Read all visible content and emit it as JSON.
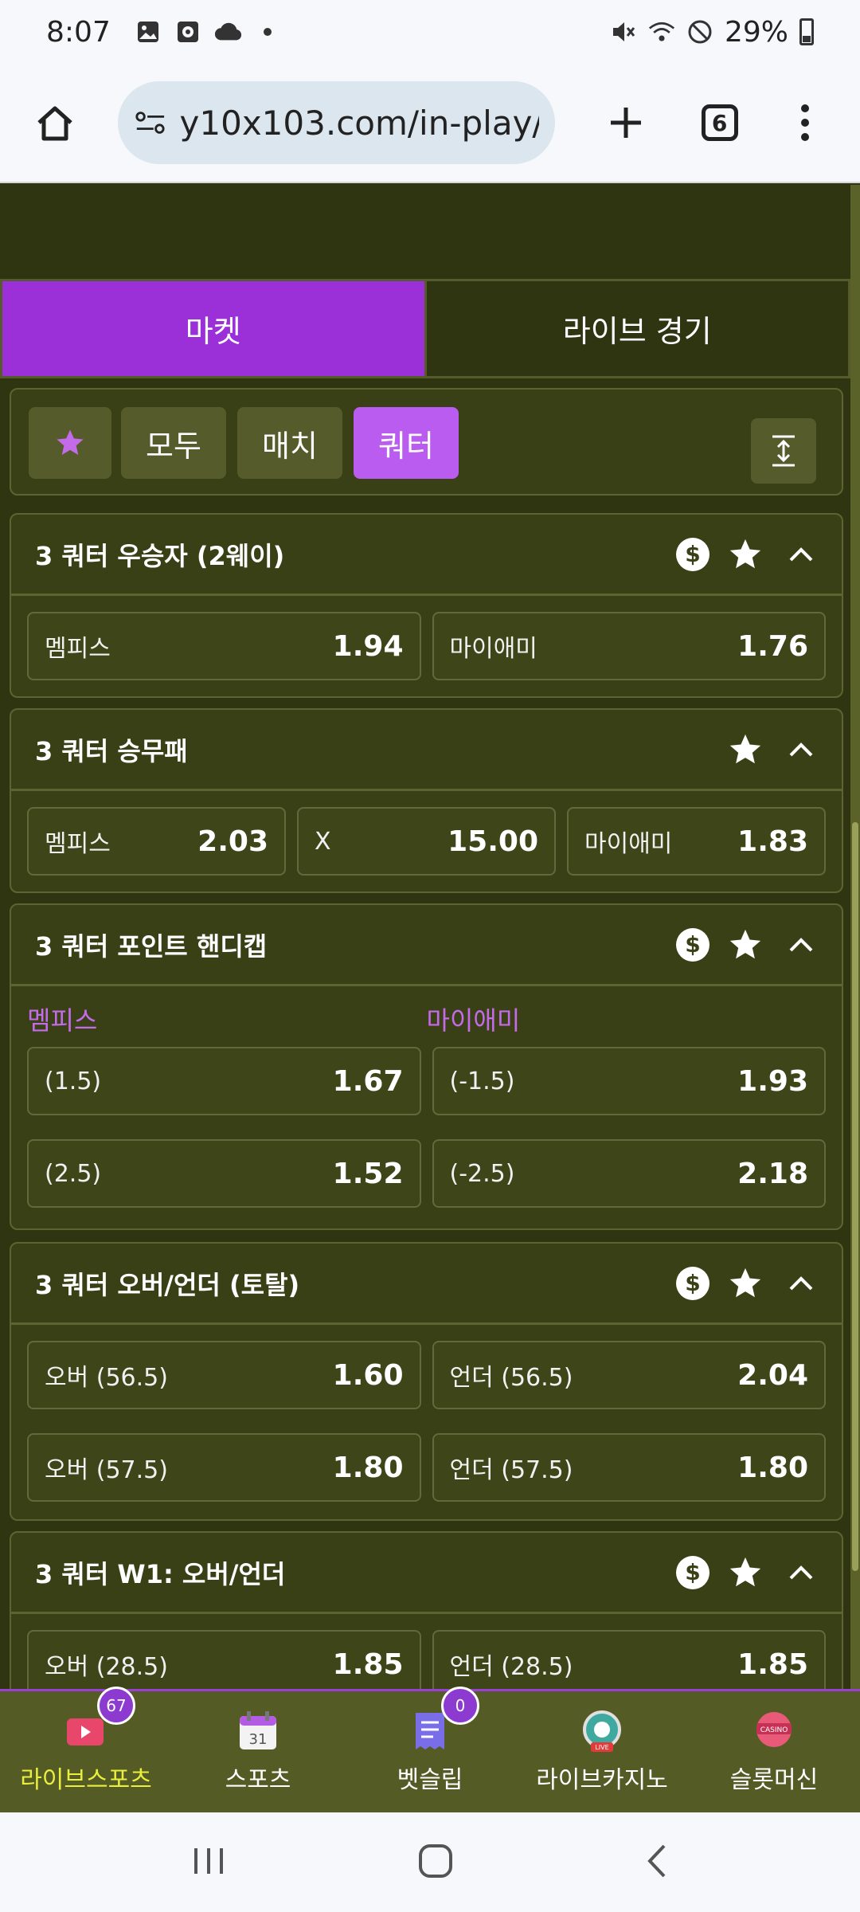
{
  "status_bar": {
    "time": "8:07",
    "battery": "29%"
  },
  "browser": {
    "url": "y10x103.com/in-play/r",
    "tab_count": "6"
  },
  "main_tabs": {
    "markets": "마켓",
    "live": "라이브 경기"
  },
  "filters": {
    "all": "모두",
    "match": "매치",
    "quarter": "쿼터"
  },
  "markets": [
    {
      "title": "3 쿼터 우승자 (2웨이)",
      "odds": [
        {
          "label": "멤피스",
          "value": "1.94"
        },
        {
          "label": "마이애미",
          "value": "1.76"
        }
      ]
    },
    {
      "title": "3 쿼터 승무패",
      "odds": [
        {
          "label": "멤피스",
          "value": "2.03"
        },
        {
          "label": "X",
          "value": "15.00"
        },
        {
          "label": "마이애미",
          "value": "1.83"
        }
      ]
    },
    {
      "title": "3 쿼터 포인트 핸디캡",
      "team_home": "멤피스",
      "team_away": "마이애미",
      "rows": [
        [
          {
            "label": "(1.5)",
            "value": "1.67"
          },
          {
            "label": "(-1.5)",
            "value": "1.93"
          }
        ],
        [
          {
            "label": "(2.5)",
            "value": "1.52"
          },
          {
            "label": "(-2.5)",
            "value": "2.18"
          }
        ]
      ]
    },
    {
      "title": "3 쿼터 오버/언더 (토탈)",
      "rows": [
        [
          {
            "label": "오버 (56.5)",
            "value": "1.60"
          },
          {
            "label": "언더 (56.5)",
            "value": "2.04"
          }
        ],
        [
          {
            "label": "오버 (57.5)",
            "value": "1.80"
          },
          {
            "label": "언더 (57.5)",
            "value": "1.80"
          }
        ]
      ]
    },
    {
      "title": "3 쿼터 W1: 오버/언더",
      "rows": [
        [
          {
            "label": "오버 (28.5)",
            "value": "1.85"
          },
          {
            "label": "언더 (28.5)",
            "value": "1.85"
          }
        ]
      ]
    }
  ],
  "bottom_nav": [
    {
      "label": "라이브스포츠",
      "badge": "67"
    },
    {
      "label": "스포츠",
      "icon_text": "31"
    },
    {
      "label": "벳슬립",
      "badge": "0"
    },
    {
      "label": "라이브카지노",
      "icon_text": "LIVE"
    },
    {
      "label": "슬롯머신",
      "icon_text": "CASINO"
    }
  ],
  "colors": {
    "accent": "#9b30d9",
    "background": "#2f3511",
    "card": "#3a4016",
    "active_nav": "#e9ef3c"
  }
}
